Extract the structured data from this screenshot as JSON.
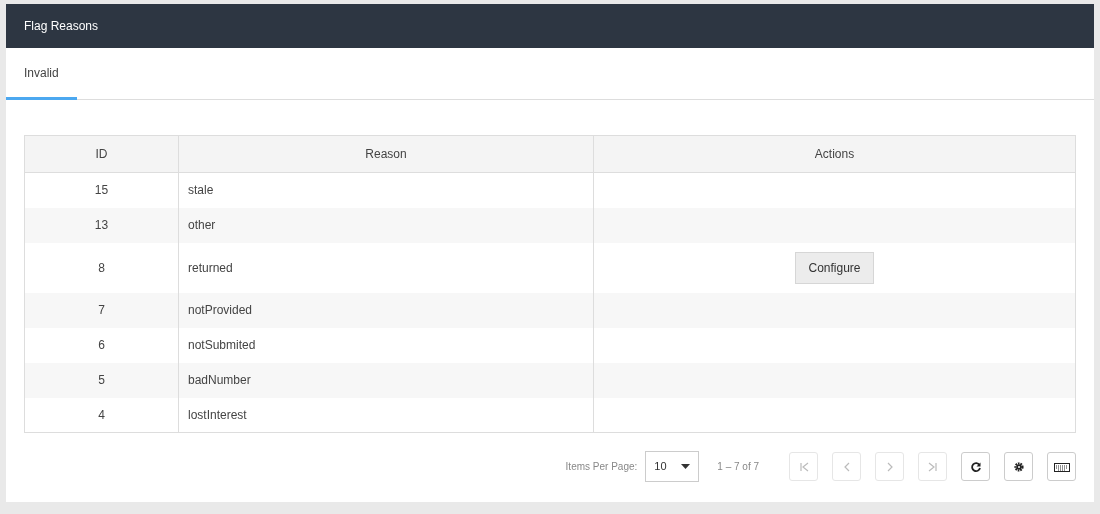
{
  "header": {
    "title": "Flag Reasons"
  },
  "tabs": [
    {
      "label": "Invalid",
      "selected": true
    }
  ],
  "table": {
    "columns": [
      "ID",
      "Reason",
      "Actions"
    ],
    "rows": [
      {
        "id": "15",
        "reason": "stale"
      },
      {
        "id": "13",
        "reason": "other"
      },
      {
        "id": "8",
        "reason": "returned",
        "action": "Configure"
      },
      {
        "id": "7",
        "reason": "notProvided"
      },
      {
        "id": "6",
        "reason": "notSubmited"
      },
      {
        "id": "5",
        "reason": "badNumber"
      },
      {
        "id": "4",
        "reason": "lostInterest"
      }
    ]
  },
  "pager": {
    "items_label": "Items Per Page:",
    "page_size": "10",
    "range": "1 – 7 of 7",
    "buttons": [
      {
        "kind": "first",
        "disabled": true
      },
      {
        "kind": "prev",
        "disabled": true
      },
      {
        "kind": "next",
        "disabled": true
      },
      {
        "kind": "last",
        "disabled": true
      },
      {
        "kind": "refresh",
        "disabled": false
      },
      {
        "kind": "settings",
        "disabled": false
      },
      {
        "kind": "keyboard",
        "disabled": false
      }
    ]
  }
}
